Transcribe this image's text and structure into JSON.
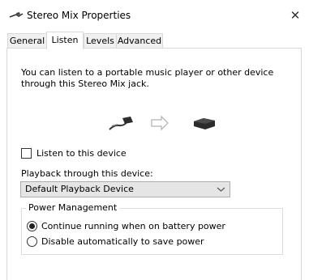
{
  "window": {
    "title": "Stereo Mix Properties",
    "close_glyph": "✕"
  },
  "tabs": [
    {
      "label": "General",
      "active": false
    },
    {
      "label": "Listen",
      "active": true
    },
    {
      "label": "Levels",
      "active": false
    },
    {
      "label": "Advanced",
      "active": false
    }
  ],
  "listen": {
    "description": "You can listen to a portable music player or other device through this Stereo Mix jack.",
    "listen_checkbox_label": "Listen to this device",
    "listen_checked": false,
    "playback_label": "Playback through this device:",
    "playback_selected": "Default Playback Device"
  },
  "power": {
    "group_title": "Power Management",
    "option_continue": "Continue running when on battery power",
    "option_disable": "Disable automatically to save power",
    "selected": "continue"
  },
  "icons": {
    "title_icon": "audio-cable-icon",
    "source": "audio-cable-icon",
    "arrow": "arrow-right-icon",
    "target": "speaker-device-icon",
    "dropdown": "chevron-down-icon"
  }
}
